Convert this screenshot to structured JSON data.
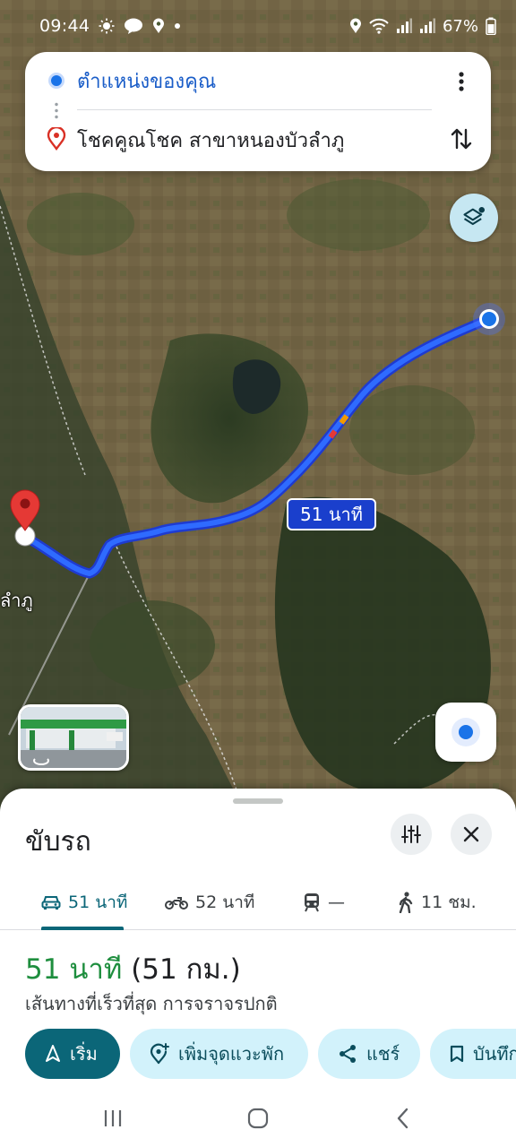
{
  "status_bar": {
    "time": "09:44",
    "battery": "67%",
    "left_icons": [
      "sun-icon",
      "line-app-icon",
      "location-icon",
      "dot-icon"
    ],
    "right_icons": [
      "location-icon",
      "wifi-icon",
      "signal-icon",
      "signal-icon",
      "battery-icon"
    ]
  },
  "directions": {
    "origin": "ตำแหน่งของคุณ",
    "destination": "โชคคูณโชค สาขาหนองบัวลำภู"
  },
  "map": {
    "eta_chip": "51 นาที",
    "place_label": "ลำภู",
    "route_color": "#1a3ff0",
    "destination_pin_color": "#e53935"
  },
  "sheet": {
    "mode_title": "ขับรถ",
    "tabs": [
      {
        "icon": "car-icon",
        "label": "51 นาที",
        "active": true
      },
      {
        "icon": "motorcycle-icon",
        "label": "52 นาที",
        "active": false
      },
      {
        "icon": "transit-icon",
        "label": "—",
        "active": false
      },
      {
        "icon": "walk-icon",
        "label": "11 ชม.",
        "active": false
      }
    ],
    "eta_time": "51 นาที",
    "eta_distance": " (51 กม.)",
    "route_description": "เส้นทางที่เร็วที่สุด การจราจรปกติ",
    "actions": {
      "start": "เริ่ม",
      "add_stop": "เพิ่มจุดแวะพัก",
      "share": "แชร์",
      "save": "บันทึก"
    }
  },
  "colors": {
    "accent": "#0b6678",
    "eta_green": "#1e8e3e",
    "link_blue": "#1a5dc8"
  }
}
